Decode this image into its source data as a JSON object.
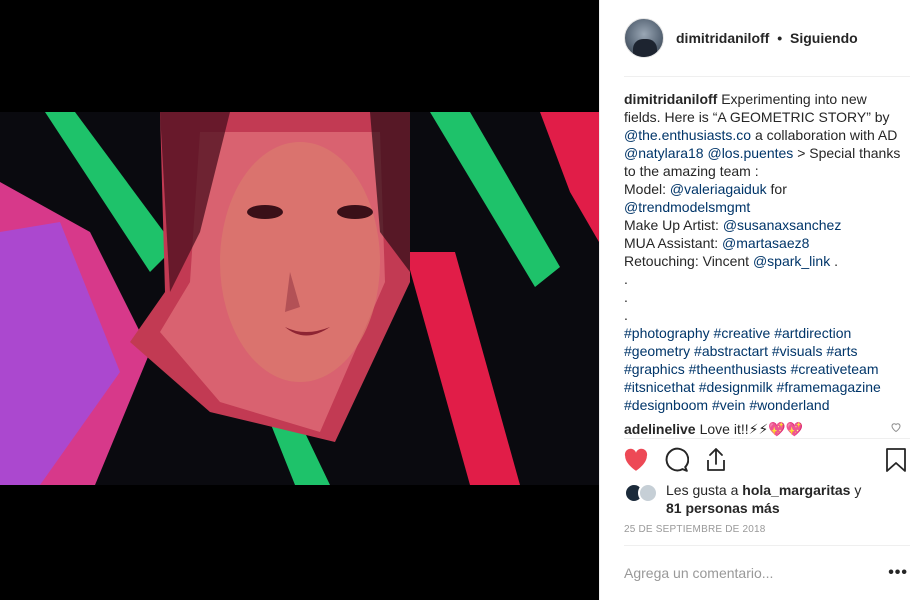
{
  "post": {
    "username": "dimitridaniloff",
    "separator": "•",
    "follow_status": "Siguiendo"
  },
  "caption": {
    "username": "dimitridaniloff",
    "lines": [
      {
        "parts": [
          {
            "t": "text",
            "v": " Experimenting into new fields. Here is “A GEOMETRIC STORY” by "
          },
          {
            "t": "mention",
            "v": "@the.enthusiasts.co"
          },
          {
            "t": "text",
            "v": " a collaboration with AD "
          },
          {
            "t": "mention",
            "v": "@natylara18"
          },
          {
            "t": "text",
            "v": " "
          },
          {
            "t": "mention",
            "v": "@los.puentes"
          },
          {
            "t": "text",
            "v": " > Special thanks to the amazing team :"
          }
        ]
      },
      {
        "parts": [
          {
            "t": "text",
            "v": "Model: "
          },
          {
            "t": "mention",
            "v": "@valeriagaiduk"
          },
          {
            "t": "text",
            "v": " for "
          },
          {
            "t": "mention",
            "v": "@trendmodelsmgmt"
          }
        ]
      },
      {
        "parts": [
          {
            "t": "text",
            "v": "Make Up Artist: "
          },
          {
            "t": "mention",
            "v": "@susanaxsanchez"
          }
        ]
      },
      {
        "parts": [
          {
            "t": "text",
            "v": "MUA Assistant: "
          },
          {
            "t": "mention",
            "v": "@martasaez8"
          }
        ]
      },
      {
        "parts": [
          {
            "t": "text",
            "v": "Retouching: Vincent "
          },
          {
            "t": "mention",
            "v": "@spark_link"
          },
          {
            "t": "text",
            "v": " ."
          }
        ]
      },
      {
        "parts": [
          {
            "t": "text",
            "v": "."
          }
        ]
      },
      {
        "parts": [
          {
            "t": "text",
            "v": "."
          }
        ]
      },
      {
        "parts": [
          {
            "t": "text",
            "v": "."
          }
        ]
      },
      {
        "parts": [
          {
            "t": "tag",
            "v": "#photography"
          },
          {
            "t": "text",
            "v": " "
          },
          {
            "t": "tag",
            "v": "#creative"
          },
          {
            "t": "text",
            "v": " "
          },
          {
            "t": "tag",
            "v": "#artdirection"
          },
          {
            "t": "text",
            "v": " "
          },
          {
            "t": "tag",
            "v": "#geometry"
          },
          {
            "t": "text",
            "v": " "
          },
          {
            "t": "tag",
            "v": "#abstractart"
          },
          {
            "t": "text",
            "v": " "
          },
          {
            "t": "tag",
            "v": "#visuals"
          },
          {
            "t": "text",
            "v": " "
          },
          {
            "t": "tag",
            "v": "#arts"
          },
          {
            "t": "text",
            "v": " "
          },
          {
            "t": "tag",
            "v": "#graphics"
          },
          {
            "t": "text",
            "v": " "
          },
          {
            "t": "tag",
            "v": "#theenthusiasts"
          },
          {
            "t": "text",
            "v": " "
          },
          {
            "t": "tag",
            "v": "#creativeteam"
          },
          {
            "t": "text",
            "v": " "
          },
          {
            "t": "tag",
            "v": "#itsnicethat"
          },
          {
            "t": "text",
            "v": " "
          },
          {
            "t": "tag",
            "v": "#designmilk"
          },
          {
            "t": "text",
            "v": " "
          },
          {
            "t": "tag",
            "v": "#framemagazine"
          },
          {
            "t": "text",
            "v": " "
          },
          {
            "t": "tag",
            "v": "#designboom"
          },
          {
            "t": "text",
            "v": " "
          },
          {
            "t": "tag",
            "v": "#vein"
          },
          {
            "t": "text",
            "v": " "
          },
          {
            "t": "tag",
            "v": "#wonderland"
          }
        ]
      }
    ]
  },
  "comment": {
    "username": "adelinelive",
    "text": "Love it!!⚡⚡💖💖"
  },
  "likes": {
    "prefix": "Les gusta a ",
    "user": "hola_margaritas",
    "middle": " y ",
    "others": "81 personas más"
  },
  "date": "25 DE SEPTIEMBRE DE 2018",
  "comment_input": {
    "placeholder": "Agrega un comentario..."
  },
  "more_label": "•••",
  "icons": {
    "like": "heart-icon",
    "comment": "comment-icon",
    "share": "share-icon",
    "save": "bookmark-icon",
    "comment_like": "small-heart-icon"
  },
  "colors": {
    "like_red": "#ed4956",
    "link_blue": "#003569",
    "muted": "#999999",
    "accent_green": "#1db954",
    "accent_pink": "#e8336a",
    "accent_violet": "#b04de0"
  }
}
